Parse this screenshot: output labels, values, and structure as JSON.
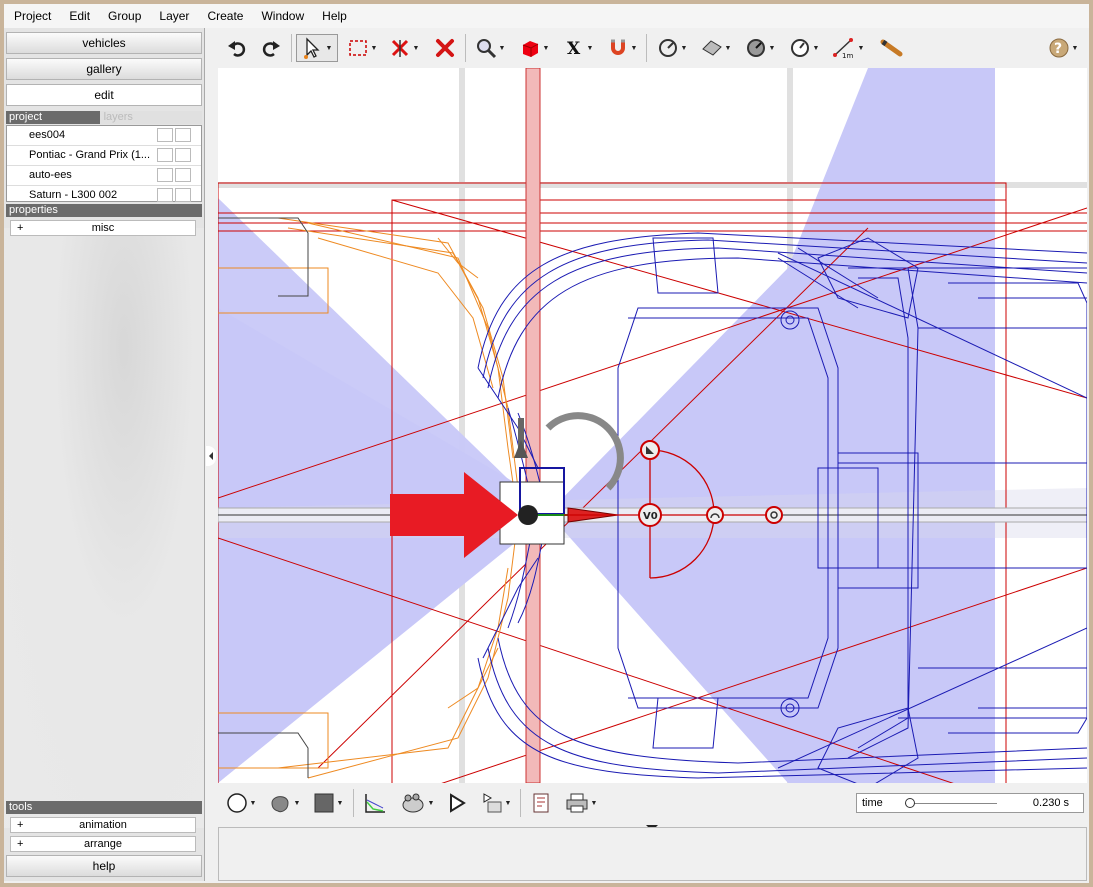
{
  "menu": [
    "Project",
    "Edit",
    "Group",
    "Layer",
    "Create",
    "Window",
    "Help"
  ],
  "sidebar": {
    "buttons": {
      "vehicles": "vehicles",
      "gallery": "gallery",
      "edit": "edit"
    },
    "project_tab": "project",
    "layers_tab": "layers",
    "projects": [
      "ees004",
      "Pontiac - Grand Prix (1...",
      "auto-ees",
      "Saturn - L300 002"
    ],
    "properties_header": "properties",
    "properties_items": [
      {
        "expander": "+",
        "label": "misc"
      }
    ],
    "tools_header": "tools",
    "tools_items": [
      {
        "expander": "+",
        "label": "animation"
      },
      {
        "expander": "+",
        "label": "arrange"
      }
    ],
    "help": "help"
  },
  "toolbar": {
    "icons": [
      "undo-icon",
      "redo-icon",
      "select-arrow-icon",
      "rectangle-select-icon",
      "point-icon",
      "delete-icon",
      "zoom-icon",
      "box-icon",
      "x-axis-icon",
      "magnet-icon",
      "gauge-icon",
      "surface-icon",
      "dial-icon",
      "clock-icon",
      "measure-icon",
      "bat-icon",
      "help-icon"
    ],
    "measure_label": "1m"
  },
  "viewport": {
    "velocity_label": "V0"
  },
  "bottom": {
    "time_label": "time",
    "time_value": "0.230 s",
    "time_fraction": 0.05
  },
  "colors": {
    "wireframe_blue": "#1b1bb3",
    "wireframe_orange": "#ee8a22",
    "guide_red": "#cc0000",
    "cone_fill": "#c8c8f8",
    "arrow_red": "#e81b24"
  }
}
